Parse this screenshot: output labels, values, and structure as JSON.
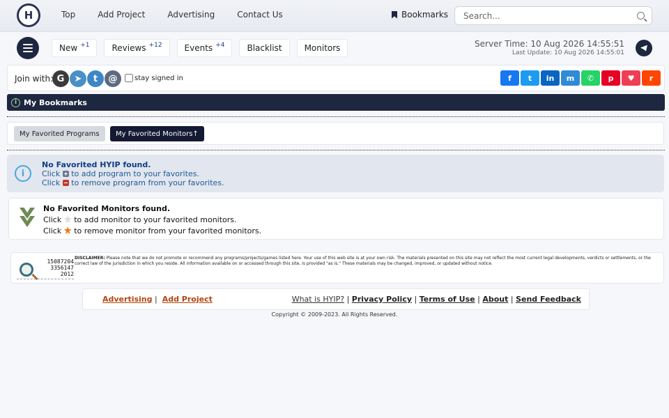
{
  "header": {
    "logo_letter": "H",
    "nav": [
      "Top",
      "Add Project",
      "Advertising",
      "Contact Us"
    ],
    "bookmarks_label": "Bookmarks",
    "search_placeholder": "Search..."
  },
  "subnav": {
    "tabs": [
      {
        "label": "New",
        "badge": "+1"
      },
      {
        "label": "Reviews",
        "badge": "+12"
      },
      {
        "label": "Events",
        "badge": "+4"
      },
      {
        "label": "Blacklist",
        "badge": ""
      },
      {
        "label": "Monitors",
        "badge": ""
      }
    ],
    "server_time": "Server Time: 10 Aug 2026 14:55:51",
    "last_update": "Last Update: 10 Aug 2026 14:55:01"
  },
  "join": {
    "label": "Join with:",
    "providers": [
      {
        "glyph": "G",
        "color": "#3b3b3b",
        "icon": "google-icon"
      },
      {
        "glyph": "➤",
        "color": "#4a8fc7",
        "icon": "telegram-icon"
      },
      {
        "glyph": "t",
        "color": "#3e86c8",
        "icon": "twitter-icon"
      },
      {
        "glyph": "@",
        "color": "#5e6a80",
        "icon": "email-icon"
      }
    ],
    "stay_signed_in": "stay signed in",
    "share": [
      {
        "glyph": "f",
        "color": "#1877f2",
        "icon": "facebook-icon"
      },
      {
        "glyph": "t",
        "color": "#1d9bf0",
        "icon": "twitter-icon"
      },
      {
        "glyph": "in",
        "color": "#0a66c2",
        "icon": "linkedin-icon"
      },
      {
        "glyph": "m",
        "color": "#2f8bd6",
        "icon": "mastodon-icon"
      },
      {
        "glyph": "✆",
        "color": "#25d366",
        "icon": "whatsapp-icon"
      },
      {
        "glyph": "p",
        "color": "#e60023",
        "icon": "pinterest-icon"
      },
      {
        "glyph": "♥",
        "color": "#ef3f56",
        "icon": "pocket-icon"
      },
      {
        "glyph": "r",
        "color": "#ff4500",
        "icon": "reddit-icon"
      }
    ]
  },
  "section": {
    "title": "My Bookmarks",
    "tabs": [
      "My Favorited Programs",
      "My Favorited Monitors↑"
    ]
  },
  "hyip_alert": {
    "title": "No Favorited HYIP found.",
    "line1_pre": "Click",
    "line1_post": "to add program to your favorites.",
    "line2_pre": "Click",
    "line2_post": "to remove program from your favorites."
  },
  "monitor_alert": {
    "title": "No Favorited Monitors found.",
    "line1_pre": "Click",
    "line1_post": "to add monitor to your favorited monitors.",
    "line2_pre": "Click",
    "line2_post": "to remove monitor from your favorited monitors."
  },
  "counter": [
    "15087204",
    "3356147",
    "2012"
  ],
  "disclaimer": {
    "label": "DISCLAIMER:",
    "text": "Please note that we do not promote or recommend any programs/projects/games listed here. Your use of this web site is at your own risk. The materials presented on this site may not reflect the most current legal developments, verdicts or settlements, or the correct law of the jurisdiction in which you reside. All information available on or accessed through this site, is provided \"as is.\" These materials may be changed, improved, or updated without notice."
  },
  "footer": {
    "left": [
      "Advertising",
      "Add Project"
    ],
    "right": [
      "What is HYIP?",
      "Privacy Policy",
      "Terms of Use",
      "About",
      "Send Feedback"
    ],
    "copyright": "Copyright © 2009-2023. All Rights Reserved."
  }
}
